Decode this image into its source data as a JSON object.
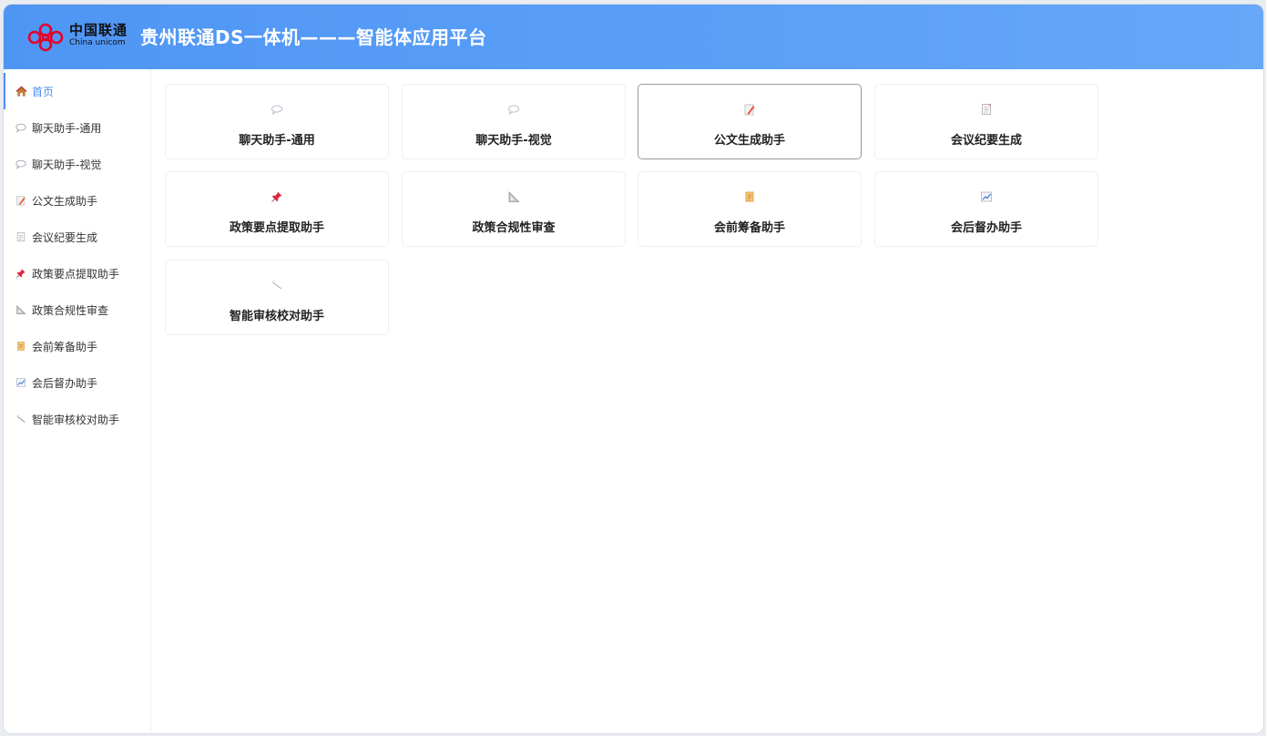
{
  "header": {
    "logo_cn": "中国联通",
    "logo_en": "China unicom",
    "title": "贵州联通DS一体机———智能体应用平台"
  },
  "sidebar": {
    "items": [
      {
        "label": "首页",
        "icon": "home-icon"
      },
      {
        "label": "聊天助手-通用",
        "icon": "chat-bubble-icon"
      },
      {
        "label": "聊天助手-视觉",
        "icon": "chat-bubble-icon"
      },
      {
        "label": "公文生成助手",
        "icon": "memo-pencil-icon"
      },
      {
        "label": "会议纪要生成",
        "icon": "document-icon"
      },
      {
        "label": "政策要点提取助手",
        "icon": "pushpin-icon"
      },
      {
        "label": "政策合规性审查",
        "icon": "triangle-ruler-icon"
      },
      {
        "label": "会前筹备助手",
        "icon": "scroll-icon"
      },
      {
        "label": "会后督办助手",
        "icon": "chart-increasing-icon"
      },
      {
        "label": "智能审核校对助手",
        "icon": "wand-icon"
      }
    ]
  },
  "cards": [
    {
      "label": "聊天助手-通用",
      "icon": "chat-bubble-icon"
    },
    {
      "label": "聊天助手-视觉",
      "icon": "chat-bubble-icon"
    },
    {
      "label": "公文生成助手",
      "icon": "memo-pencil-icon"
    },
    {
      "label": "会议纪要生成",
      "icon": "document-icon"
    },
    {
      "label": "政策要点提取助手",
      "icon": "pushpin-icon"
    },
    {
      "label": "政策合规性审查",
      "icon": "triangle-ruler-icon"
    },
    {
      "label": "会前筹备助手",
      "icon": "scroll-icon"
    },
    {
      "label": "会后督办助手",
      "icon": "chart-increasing-icon"
    },
    {
      "label": "智能审核校对助手",
      "icon": "wand-icon"
    }
  ],
  "colors": {
    "header_gradient_start": "#4f95f4",
    "header_gradient_end": "#66a7f8",
    "accent": "#4f8ef1",
    "logo_red": "#e60027"
  }
}
